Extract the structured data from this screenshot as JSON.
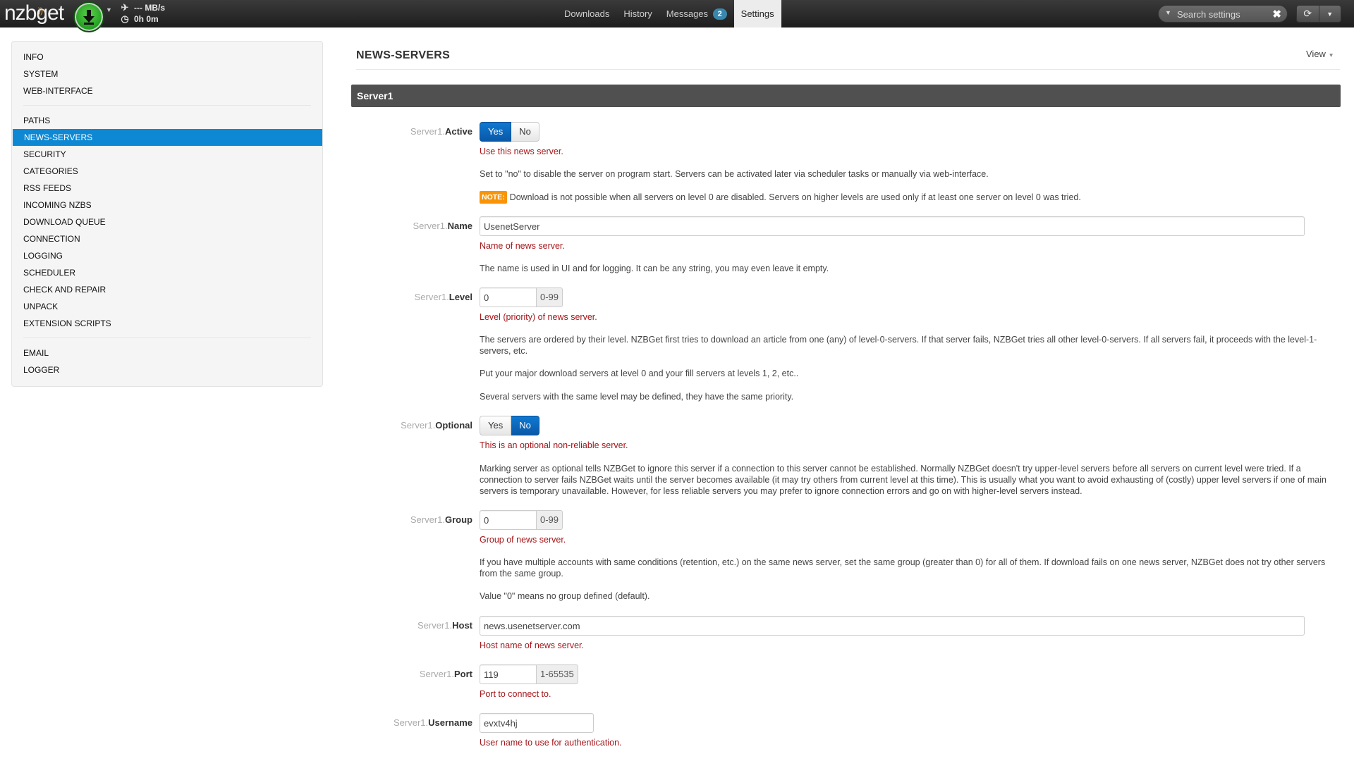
{
  "app": {
    "logo": "nzbget",
    "speed": "--- MB/s",
    "time": "0h 0m"
  },
  "nav": {
    "downloads": "Downloads",
    "history": "History",
    "messages": "Messages",
    "messages_count": "2",
    "settings": "Settings"
  },
  "search": {
    "placeholder": "Search settings"
  },
  "sidebar": {
    "group1": [
      "INFO",
      "SYSTEM",
      "WEB-INTERFACE"
    ],
    "group2": [
      "PATHS",
      "NEWS-SERVERS",
      "SECURITY",
      "CATEGORIES",
      "RSS FEEDS",
      "INCOMING NZBS",
      "DOWNLOAD QUEUE",
      "CONNECTION",
      "LOGGING",
      "SCHEDULER",
      "CHECK AND REPAIR",
      "UNPACK",
      "EXTENSION SCRIPTS"
    ],
    "group3": [
      "EMAIL",
      "LOGGER"
    ],
    "active": "NEWS-SERVERS"
  },
  "page": {
    "title": "NEWS-SERVERS",
    "view": "View",
    "section": "Server1"
  },
  "options": {
    "prefix": "Server1.",
    "active": {
      "label": "Active",
      "yes": "Yes",
      "no": "No",
      "selected": "Yes",
      "desc": "Use this news server.",
      "help": "Set to \"no\" to disable the server on program start. Servers can be activated later via scheduler tasks or manually via web-interface.",
      "note_label": "NOTE:",
      "note": "Download is not possible when all servers on level 0 are disabled. Servers on higher levels are used only if at least one server on level 0 was tried."
    },
    "name": {
      "label": "Name",
      "value": "UsenetServer",
      "desc": "Name of news server.",
      "help": "The name is used in UI and for logging. It can be any string, you may even leave it empty."
    },
    "level": {
      "label": "Level",
      "value": "0",
      "range": "0-99",
      "desc": "Level (priority) of news server.",
      "help1": "The servers are ordered by their level. NZBGet first tries to download an article from one (any) of level-0-servers. If that server fails, NZBGet tries all other level-0-servers. If all servers fail, it proceeds with the level-1-servers, etc.",
      "help2": "Put your major download servers at level 0 and your fill servers at levels 1, 2, etc..",
      "help3": "Several servers with the same level may be defined, they have the same priority."
    },
    "optional": {
      "label": "Optional",
      "yes": "Yes",
      "no": "No",
      "selected": "No",
      "desc": "This is an optional non-reliable server.",
      "help": "Marking server as optional tells NZBGet to ignore this server if a connection to this server cannot be established. Normally NZBGet doesn't try upper-level servers before all servers on current level were tried. If a connection to server fails NZBGet waits until the server becomes available (it may try others from current level at this time). This is usually what you want to avoid exhausting of (costly) upper level servers if one of main servers is temporary unavailable. However, for less reliable servers you may prefer to ignore connection errors and go on with higher-level servers instead."
    },
    "group": {
      "label": "Group",
      "value": "0",
      "range": "0-99",
      "desc": "Group of news server.",
      "help1": "If you have multiple accounts with same conditions (retention, etc.) on the same news server, set the same group (greater than 0) for all of them. If download fails on one news server, NZBGet does not try other servers from the same group.",
      "help2": "Value \"0\" means no group defined (default)."
    },
    "host": {
      "label": "Host",
      "value": "news.usenetserver.com",
      "desc": "Host name of news server."
    },
    "port": {
      "label": "Port",
      "value": "119",
      "range": "1-65535",
      "desc": "Port to connect to."
    },
    "username": {
      "label": "Username",
      "value": "evxtv4hj",
      "desc": "User name to use for authentication."
    }
  },
  "icons": {
    "play": "download-arrow-icon",
    "speed": "plane-icon",
    "time": "clock-icon",
    "refresh": "refresh-icon"
  },
  "colors": {
    "accent": "#0e88d3",
    "button_on": "#0a58a8",
    "desc_red": "#a4161a",
    "note": "#f89406",
    "play_green": "#2bb32b"
  }
}
